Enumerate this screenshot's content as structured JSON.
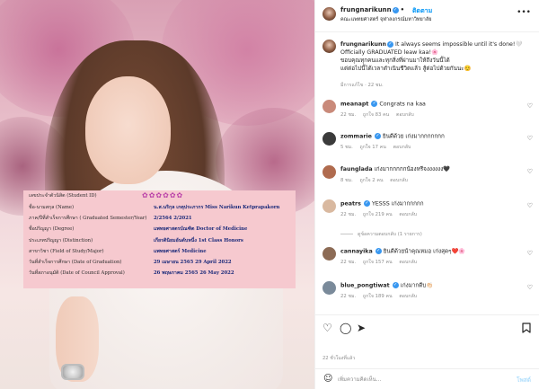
{
  "header": {
    "username": "frungnarikunn",
    "follow_label": "ติดตาม",
    "subtitle": "คณะแพทยศาสตร์ จุฬาลงกรณ์มหาวิทยาลัย",
    "more_icon": "more-horizontal-icon"
  },
  "caption": {
    "username": "frungnarikunn",
    "line1": "It always seems impossible until it's done!🤍",
    "line2": "Officially GRADUATED leaw kaa!🌸",
    "line3": "ขอบคุณทุกคนและทุกสิ่งที่ผ่านมาให้ถึงวันนี้ได้",
    "line4": "แต่ต่อไปนี้ได้เวลาดำเนินชีวิตแล้ว สู้ต่อไปด้วยกันนะ☺️",
    "meta": "มีการแก้ไข · 22 ชม."
  },
  "comments": [
    {
      "username": "meanapt",
      "text": "Congrats na kaa",
      "time": "22 ชม.",
      "likes": "ถูกใจ 83 คน",
      "reply": "ตอบกลับ",
      "avatar": "#c98a7a"
    },
    {
      "username": "zommarie",
      "text": "ยินดีด้วย เก่งมากกกกกกก",
      "time": "5 ชม.",
      "likes": "ถูกใจ 17 คน",
      "reply": "ตอบกลับ",
      "avatar": "#3b3b3b"
    },
    {
      "username": "faunglada",
      "text": "เก่งมากกกกกน้องหรีจงงงงงง🖤",
      "time": "8 ชม.",
      "likes": "ถูกใจ 2 คน",
      "reply": "ตอบกลับ",
      "avatar": "#b06b4e"
    },
    {
      "username": "peatrs",
      "text": "YESSS เก่งมากกกกก",
      "time": "22 ชม.",
      "likes": "ถูกใจ 219 คน",
      "reply": "ตอบกลับ",
      "avatar": "#d9b9a0"
    },
    {
      "username": "cannayika",
      "text": "ยินดีด้วยน้าคุณหมอ เก่งสุดๆ❤️🌸",
      "time": "22 ชม.",
      "likes": "ถูกใจ 157 คน",
      "reply": "ตอบกลับ",
      "avatar": "#8c6b55"
    },
    {
      "username": "blue_pongtiwat",
      "text": "เก่งมากดีบ👏🏻",
      "time": "22 ชม.",
      "likes": "ถูกใจ 189 คน",
      "reply": "ตอบกลับ",
      "avatar": "#7a8a9a"
    }
  ],
  "replies_toggle": "ดูข้อความตอบกลับ (1 รายการ)",
  "actions": {
    "like_icon": "heart-icon",
    "comment_icon": "comment-icon",
    "share_icon": "send-icon",
    "save_icon": "bookmark-icon"
  },
  "likes_text": "22 ชั่วโมงที่แล้ว",
  "composer": {
    "placeholder": "เพิ่มความคิดเห็น...",
    "post_label": "โพสต์",
    "emoji_icon": "smiley-icon"
  },
  "certificate": {
    "flowers": "✿✿✿✿✿✿",
    "rows": [
      {
        "label": "เลขประจำตัวนิสิต (Student ID)",
        "value": ""
      },
      {
        "label": "ชื่อ-นามสกุล (Name)",
        "value": "น.ส.นริกุล เกตุประภากร   Miss Narikun Ketprapakorn"
      },
      {
        "label": "ภาค/ปีที่สำเร็จการศึกษา ( Graduated Semester/Year)",
        "value": "2/2564   2/2021"
      },
      {
        "label": "ชื่อปริญญา (Degree)",
        "value": "แพทยศาสตรบัณฑิต   Doctor of Medicine"
      },
      {
        "label": "ประเภทปริญญา (Distinction)",
        "value": "เกียรตินิยมอันดับหนึ่ง   1st Class Honors"
      },
      {
        "label": "สาขาวิชา (Field of Study/Major)",
        "value": "แพทยศาสตร์   Medicine"
      },
      {
        "label": "วันที่สำเร็จการศึกษา (Date of Graduation)",
        "value": "29 เมษายน 2565   29 April 2022"
      },
      {
        "label": "วันที่สภาอนุมัติ (Date of Council Approval)",
        "value": "26 พฤษภาคม 2565   26 May 2022"
      }
    ]
  }
}
